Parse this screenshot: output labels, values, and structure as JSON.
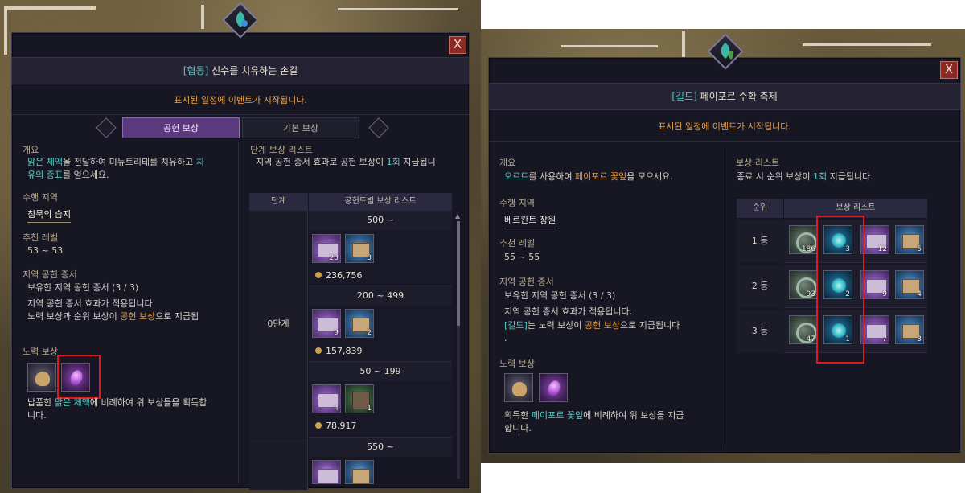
{
  "left": {
    "title_tag": "[협동]",
    "title": "신수를 치유하는 손길",
    "notice": "표시된 일정에 이벤트가 시작됩니다.",
    "tabs": [
      "공헌 보상",
      "기본 보상"
    ],
    "overview": {
      "heading": "개요",
      "line1_hl": "맑은 체액",
      "line1_rest": "을 전달하여 미뉴트리테를 치유하고",
      "line1_hl2": "치",
      "line2_hl": "유의 증표",
      "line2_rest": "를 얻으세요."
    },
    "region": {
      "heading": "수행 지역",
      "value": "침묵의 습지"
    },
    "level": {
      "heading": "추천 레벨",
      "value": "53 ~ 53"
    },
    "proof": {
      "heading": "지역 공헌 증서",
      "line1": "보유한 지역 공헌 증서 (3 / 3)",
      "line2": "지역 공헌 증서 효과가 적용됩니다.",
      "line3_a": "노력 보상과 순위 보상이",
      "line3_hl": "공헌 보상",
      "line3_b": "으로 지급됩"
    },
    "effort": {
      "heading": "노력 보상",
      "desc_a": "납품한",
      "desc_hl": "맑은 체액",
      "desc_b": "에 비례하여 위 보상들을 획득합",
      "desc_c": "니다."
    },
    "stage_list": {
      "heading": "단계 보상 리스트",
      "desc_a": "지역 공헌 증서 효과로 공헌 보상이",
      "desc_hl": "1회",
      "desc_b": "지급됩니",
      "col_stage": "단계",
      "col_list": "공헌도별 보상 리스트",
      "stage_label": "0단계",
      "rows": [
        {
          "range": "500 ~",
          "counts": [
            "23",
            "3"
          ],
          "coin": "236,756"
        },
        {
          "range": "200 ~ 499",
          "counts": [
            "9",
            "2"
          ],
          "coin": "157,839"
        },
        {
          "range": "50 ~ 199",
          "counts": [
            "4",
            "1"
          ],
          "coin": "78,917"
        },
        {
          "range": "550 ~",
          "counts": [
            "",
            ""
          ],
          "coin": ""
        }
      ]
    }
  },
  "right": {
    "title_tag": "[길드]",
    "title": "페이포르 수확 축제",
    "notice": "표시된 일정에 이벤트가 시작됩니다.",
    "overview": {
      "heading": "개요",
      "hl1": "오르트",
      "mid": "를 사용하여",
      "hl2": "페이포르 꽃잎",
      "end": "을 모으세요."
    },
    "region": {
      "heading": "수행 지역",
      "value": "베르칸트 장원"
    },
    "level": {
      "heading": "추천 레벨",
      "value": "55 ~ 55"
    },
    "proof": {
      "heading": "지역 공헌 증서",
      "line1": "보유한 지역 공헌 증서 (3 / 3)",
      "line2": "지역 공헌 증서 효과가 적용됩니다.",
      "line3_hl": "[길드]",
      "line3_a": "는 노력 보상이",
      "line3_hl2": "공헌 보상",
      "line3_b": "으로 지급됩니다",
      "line4": "."
    },
    "effort": {
      "heading": "노력 보상",
      "desc_a": "획득한",
      "desc_hl": "페이포르 꽃잎",
      "desc_b": "에 비례하여 위 보상을 지급",
      "desc_c": "합니다."
    },
    "rank_list": {
      "heading": "보상 리스트",
      "desc_a": "종료 시 순위 보상이",
      "desc_hl": "1회",
      "desc_b": "지급됩니다.",
      "col_rank": "순위",
      "col_list": "보상 리스트",
      "rows": [
        {
          "rank": "1 등",
          "counts": [
            "186",
            "3",
            "12",
            "5"
          ]
        },
        {
          "rank": "2 등",
          "counts": [
            "93",
            "2",
            "9",
            "4"
          ]
        },
        {
          "rank": "3 등",
          "counts": [
            "47",
            "1",
            "7",
            "3"
          ]
        }
      ]
    }
  },
  "close_glyph": "X"
}
